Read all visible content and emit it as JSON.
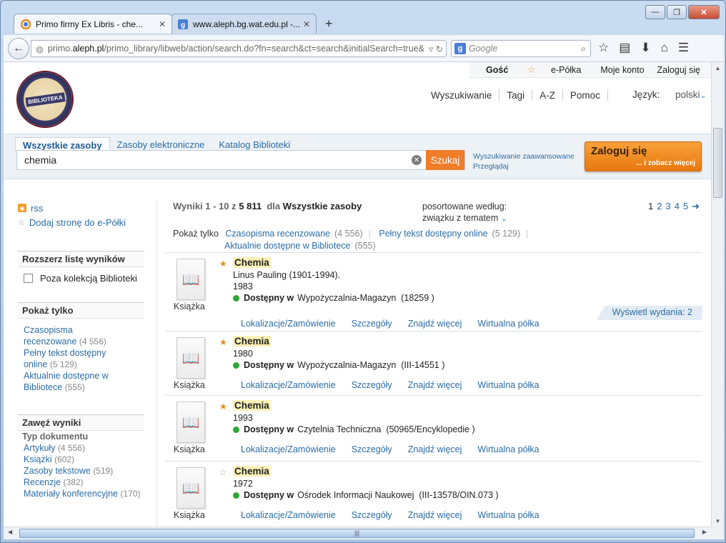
{
  "browser": {
    "tabs": [
      {
        "title": "Primo firmy Ex Libris - che...",
        "active": true
      },
      {
        "title": "www.aleph.bg.wat.edu.pl -...",
        "active": false
      }
    ],
    "new_tab": "+",
    "url_prefix": "primo.",
    "url_host": "aleph.pl",
    "url_rest": "/primo_library/libweb/action/search.do?fn=search&ct=search&initialSearch=true&",
    "search_placeholder": "Google",
    "window_controls": {
      "minimize": "—",
      "maximize": "❐",
      "close": "✕"
    }
  },
  "userbar": {
    "guest": "Gość",
    "eshelf": "e-Półka",
    "account": "Moje konto",
    "login": "Zaloguj się"
  },
  "mainmenu": {
    "items": [
      "Wyszukiwanie",
      "Tagi",
      "A-Z",
      "Pomoc"
    ],
    "lang_label": "Język:",
    "lang_value": "polski"
  },
  "logo_text": "BIBLIOTEKA",
  "search": {
    "tabs": [
      "Wszystkie zasoby",
      "Zasoby elektroniczne",
      "Katalog Biblioteki"
    ],
    "query": "chemia",
    "button": "Szukaj",
    "advanced": "Wyszukiwanie zaawansowane",
    "browse": "Przeglądaj",
    "login_title": "Zaloguj się",
    "login_sub": "... i zobacz więcej"
  },
  "left": {
    "rss": "rss",
    "add_page": "Dodaj stronę do e-Półki",
    "expand_head": "Rozszerz listę wyników",
    "expand_opt": "Poza kolekcją Biblioteki",
    "show_head": "Pokaż tylko",
    "show_items": [
      {
        "label": "Czasopisma recenzowane",
        "count": "(4 556)"
      },
      {
        "label": "Pełny tekst dostępny online",
        "count": "(5 129)"
      },
      {
        "label": "Aktualnie dostępne w Bibliotece",
        "count": "(555)"
      }
    ],
    "narrow_head": "Zawęź wyniki",
    "doc_type": "Typ dokumentu",
    "narrow_items": [
      {
        "label": "Artykuły",
        "count": "(4 556)"
      },
      {
        "label": "Książki",
        "count": "(602)"
      },
      {
        "label": "Zasoby tekstowe",
        "count": "(519)"
      },
      {
        "label": "Recenzje",
        "count": "(382)"
      },
      {
        "label": "Materiały konferencyjne",
        "count": "(170)"
      }
    ]
  },
  "results": {
    "range": "Wyniki 1 - 10 z",
    "total": "5 811",
    "for": "dla",
    "scope": "Wszystkie zasoby",
    "sort_label": "posortowane według:",
    "sort_value": "związku z tematem",
    "pages": [
      "1",
      "2",
      "3",
      "4",
      "5"
    ],
    "next": "➜",
    "show_only_label": "Pokaż tylko",
    "show_only": [
      {
        "label": "Czasopisma recenzowane",
        "count": "(4 556)"
      },
      {
        "label": "Pełny tekst dostępny online",
        "count": "(5 129)"
      },
      {
        "label": "Aktualnie dostępne w Bibliotece",
        "count": "(555)"
      }
    ],
    "actions": [
      "Lokalizacje/Zamówienie",
      "Szczegóły",
      "Znajdź więcej",
      "Wirtualna półka"
    ],
    "available_label": "Dostępny w",
    "records": [
      {
        "type": "Książka",
        "title": "Chemia",
        "author": "Linus Pauling (1901-1994).",
        "year": "1983",
        "location": "Wypożyczalnia-Magazyn",
        "call": "(18259 )",
        "starred": true,
        "editions": "Wyświetl wydania: 2"
      },
      {
        "type": "Książka",
        "title": "Chemia",
        "author": "",
        "year": "1980",
        "location": "Wypożyczalnia-Magazyn",
        "call": "(III-14551 )",
        "starred": true
      },
      {
        "type": "Książka",
        "title": "Chemia",
        "author": "",
        "year": "1993",
        "location": "Czytelnia Techniczna",
        "call": "(50965/Encyklopedie )",
        "starred": true
      },
      {
        "type": "Książka",
        "title": "Chemia",
        "author": "",
        "year": "1972",
        "location": "Ośrodek Informacji Naukowej",
        "call": "(III-13578/OIN.073 )",
        "starred": false
      }
    ]
  },
  "colors": {
    "accent": "#f07d28",
    "link": "#2b6ca6",
    "available": "#2ca636"
  }
}
